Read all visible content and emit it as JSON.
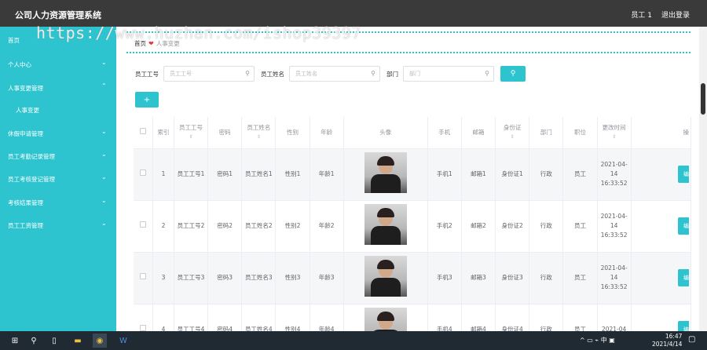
{
  "app": {
    "title": "公司人力资源管理系统"
  },
  "topbar": {
    "user": "员工 1",
    "logout": "退出登录"
  },
  "watermark": "https://www.huzhan.com/ishop39397",
  "sidebar": {
    "items": [
      {
        "label": "首页",
        "chevron": ""
      },
      {
        "label": "个人中心",
        "chevron": "⌄"
      },
      {
        "label": "人事变更管理",
        "chevron": "⌃"
      },
      {
        "label": "人事变更",
        "chevron": ""
      },
      {
        "label": "休假申请管理",
        "chevron": "⌄"
      },
      {
        "label": "员工考勤记录管理",
        "chevron": "⌄"
      },
      {
        "label": "员工考核登记管理",
        "chevron": "⌄"
      },
      {
        "label": "考核结果管理",
        "chevron": "⌄"
      },
      {
        "label": "员工工资管理",
        "chevron": "⌄"
      }
    ]
  },
  "breadcrumb": {
    "home": "首页",
    "sep": "❤",
    "current": "人事变更"
  },
  "search": {
    "emp_no_label": "员工工号",
    "emp_no_placeholder": "员工工号",
    "emp_name_label": "员工姓名",
    "emp_name_placeholder": "员工姓名",
    "dept_label": "部门",
    "dept_placeholder": "部门",
    "button_icon": "search-icon",
    "button_glyph": "⚲"
  },
  "add_button": {
    "glyph": "+"
  },
  "table": {
    "headers": [
      "",
      "索引",
      "员工工号",
      "密码",
      "员工姓名",
      "性别",
      "年龄",
      "头像",
      "手机",
      "邮箱",
      "身份证",
      "部门",
      "职位",
      "更改时间",
      "操"
    ],
    "sort_glyph": "⇕",
    "rows": [
      {
        "index": "1",
        "emp_no": "员工工号1",
        "password": "密码1",
        "name": "员工姓名1",
        "gender": "性别1",
        "age": "年龄1",
        "phone": "手机1",
        "email": "邮箱1",
        "id_card": "身份证1",
        "dept": "行政",
        "position": "员工",
        "time": "2021-04-14 16:33:52",
        "action": "编"
      },
      {
        "index": "2",
        "emp_no": "员工工号2",
        "password": "密码2",
        "name": "员工姓名2",
        "gender": "性别2",
        "age": "年龄2",
        "phone": "手机2",
        "email": "邮箱2",
        "id_card": "身份证2",
        "dept": "行政",
        "position": "员工",
        "time": "2021-04-14 16:33:52",
        "action": "编"
      },
      {
        "index": "3",
        "emp_no": "员工工号3",
        "password": "密码3",
        "name": "员工姓名3",
        "gender": "性别3",
        "age": "年龄3",
        "phone": "手机3",
        "email": "邮箱3",
        "id_card": "身份证3",
        "dept": "行政",
        "position": "员工",
        "time": "2021-04-14 16:33:52",
        "action": "编"
      },
      {
        "index": "4",
        "emp_no": "员工工号4",
        "password": "密码4",
        "name": "员工姓名4",
        "gender": "性别4",
        "age": "年龄4",
        "phone": "手机4",
        "email": "邮箱4",
        "id_card": "身份证4",
        "dept": "行政",
        "position": "员工",
        "time": "2021-04",
        "action": "编"
      }
    ]
  },
  "taskbar": {
    "tray": "^ ▭ ⌁ 中 ▣",
    "time": "16:47",
    "date": "2021/4/14"
  },
  "colors": {
    "accent": "#2ec4cf",
    "topbar": "#3a3a3a",
    "taskbar": "#1f2a33"
  }
}
